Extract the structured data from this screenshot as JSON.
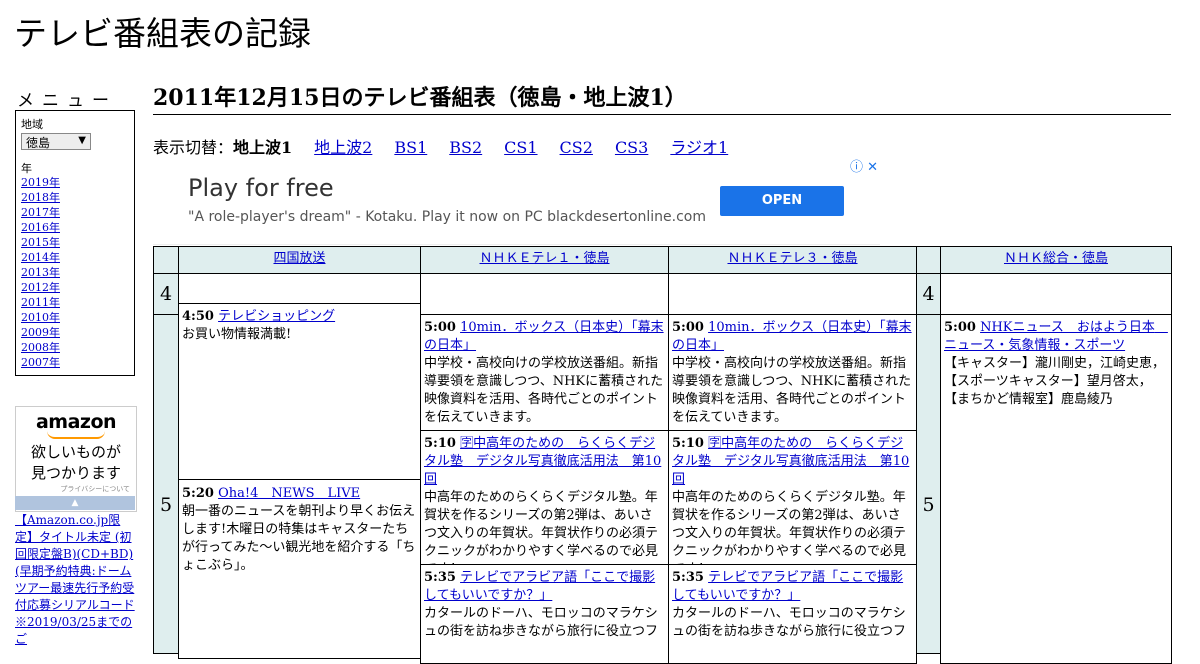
{
  "site": {
    "title": "テレビ番組表の記録"
  },
  "sidebar": {
    "menu_heading": "メニュー",
    "region_label": "地域",
    "region_value": "徳島",
    "year_label": "年",
    "years": [
      "2019年",
      "2018年",
      "2017年",
      "2016年",
      "2015年",
      "2014年",
      "2013年",
      "2012年",
      "2011年",
      "2010年",
      "2009年",
      "2008年",
      "2007年"
    ],
    "amazon": {
      "logo": "amazon",
      "line1": "欲しいものが",
      "line2": "見つかります",
      "privacy": "プライバシーについて",
      "caption": "【Amazon.co.jp限定】タイトル未定 (初回限定盤B)(CD+BD)(早期予約特典:ドームツアー最速先行予約受付応募シリアルコード※2019/03/25までのご"
    }
  },
  "main": {
    "title": "2011年12月15日のテレビ番組表（徳島・地上波1）",
    "switch_label": "表示切替：",
    "switch_current": "地上波1",
    "switch_links": [
      "地上波2",
      "BS1",
      "BS2",
      "CS1",
      "CS2",
      "CS3",
      "ラジオ1"
    ]
  },
  "ad": {
    "title": "Play for free",
    "desc": "\"A role-player's dream\" - Kotaku. Play it now on PC blackdesertonline.com",
    "button": "OPEN",
    "icons": "ⓘ ✕"
  },
  "schedule": {
    "channels": [
      "四国放送",
      "ＮＨＫＥテレ１・徳島",
      "ＮＨＫＥテレ３・徳島",
      "ＮＨＫ総合・徳島"
    ],
    "hours": [
      "4",
      "5"
    ],
    "programs": {
      "ch0_p1": {
        "time": "4:50",
        "title": "テレビショッピング",
        "desc": "お買い物情報満載!"
      },
      "ch0_p2": {
        "time": "5:20",
        "title": "Oha!4　NEWS　LIVE",
        "desc": "朝一番のニュースを朝刊より早くお伝えします!木曜日の特集はキャスターたちが行ってみた～い観光地を紹介する「ちょこぶら」。"
      },
      "ch1_p1": {
        "time": "5:00",
        "title": "10min．ボックス（日本史）「幕末の日本」",
        "desc": "中学校・高校向けの学校放送番組。新指導要領を意識しつつ、NHKに蓄積された映像資料を活用、各時代ごとのポイントを伝えていきます。"
      },
      "ch1_p2": {
        "time": "5:10",
        "title": "🈑中高年のための　らくらくデジタル塾　デジタル写真徹底活用法　第10回",
        "desc": "中高年のためのらくらくデジタル塾。年賀状を作るシリーズの第2弾は、あいさつ文入りの年賀状。年賀状作りの必須テクニックがわかりやすく学べるので必見です！"
      },
      "ch1_p3": {
        "time": "5:35",
        "title": "テレビでアラビア語「ここで撮影してもいいですか？」",
        "desc": "カタールのドーハ、モロッコのマラケシュの街を訪ね歩きながら旅行に役立つフ"
      },
      "ch2_p1": {
        "time": "5:00",
        "title": "10min．ボックス（日本史）「幕末の日本」",
        "desc": "中学校・高校向けの学校放送番組。新指導要領を意識しつつ、NHKに蓄積された映像資料を活用、各時代ごとのポイントを伝えていきます。"
      },
      "ch2_p2": {
        "time": "5:10",
        "title": "🈑中高年のための　らくらくデジタル塾　デジタル写真徹底活用法　第10回",
        "desc": "中高年のためのらくらくデジタル塾。年賀状を作るシリーズの第2弾は、あいさつ文入りの年賀状。年賀状作りの必須テクニックがわかりやすく学べるので必見です！"
      },
      "ch2_p3": {
        "time": "5:35",
        "title": "テレビでアラビア語「ここで撮影してもいいですか？」",
        "desc": "カタールのドーハ、モロッコのマラケシュの街を訪ね歩きながら旅行に役立つフ"
      },
      "ch3_p1": {
        "time": "5:00",
        "title": "NHKニュース　おはよう日本　ニュース・気象情報・スポーツ",
        "desc": "【キャスター】瀧川剛史，江崎史恵，【スポーツキャスター】望月啓太，【まちかど情報室】鹿島綾乃"
      }
    }
  }
}
